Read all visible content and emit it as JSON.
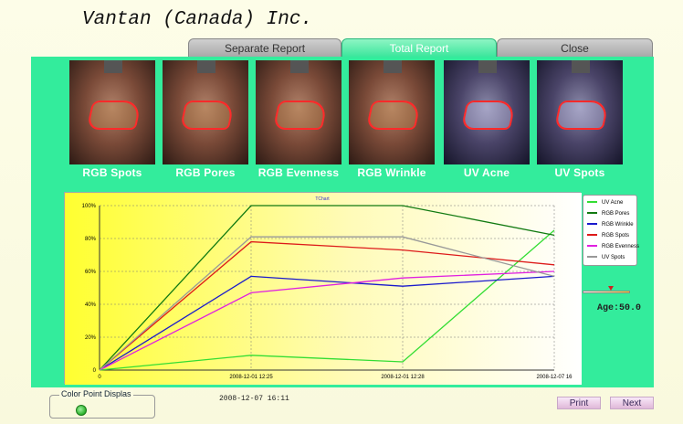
{
  "app": {
    "title": "Vantan (Canada) Inc."
  },
  "tabs": [
    {
      "label": "Separate Report",
      "active": false
    },
    {
      "label": "Total Report",
      "active": true
    },
    {
      "label": "Close",
      "active": false
    }
  ],
  "thumbnails": [
    {
      "label": "RGB Spots",
      "mode": "rgb"
    },
    {
      "label": "RGB Pores",
      "mode": "rgb"
    },
    {
      "label": "RGB Evenness",
      "mode": "rgb"
    },
    {
      "label": "RGB Wrinkle",
      "mode": "rgb"
    },
    {
      "label": "UV Acne",
      "mode": "uv"
    },
    {
      "label": "UV Spots",
      "mode": "uv"
    }
  ],
  "chart_data": {
    "type": "line",
    "title": "TChart",
    "categories": [
      "",
      "2008-12-01 12:25",
      "2008-12-01 12:28",
      "2008-12-07 16"
    ],
    "y_ticks": [
      "0",
      "20%",
      "40%",
      "60%",
      "80%",
      "100%"
    ],
    "ylim": [
      0,
      100
    ],
    "grid": true,
    "legend_position": "right",
    "series": [
      {
        "name": "UV Acne",
        "color": "#33dd33",
        "values": [
          0,
          9,
          5,
          85
        ]
      },
      {
        "name": "RGB Pores",
        "color": "#117a11",
        "values": [
          0,
          100,
          100,
          82
        ]
      },
      {
        "name": "RGB Wrinkle",
        "color": "#1a1acc",
        "values": [
          0,
          57,
          51,
          57
        ]
      },
      {
        "name": "RGB Spots",
        "color": "#dd1a1a",
        "values": [
          0,
          78,
          73,
          64
        ]
      },
      {
        "name": "RGB Evenness",
        "color": "#e020e0",
        "values": [
          0,
          47,
          56,
          60
        ]
      },
      {
        "name": "UV Spots",
        "color": "#999999",
        "values": [
          0,
          81,
          81,
          57
        ]
      }
    ]
  },
  "age": {
    "label": "Age:50.0",
    "value": 50.0,
    "slider_fraction": 0.6
  },
  "color_point": {
    "title": "Color Point Displas",
    "selected": true
  },
  "timestamp": "2008-12-07  16:11",
  "buttons": {
    "print": "Print",
    "next": "Next"
  }
}
